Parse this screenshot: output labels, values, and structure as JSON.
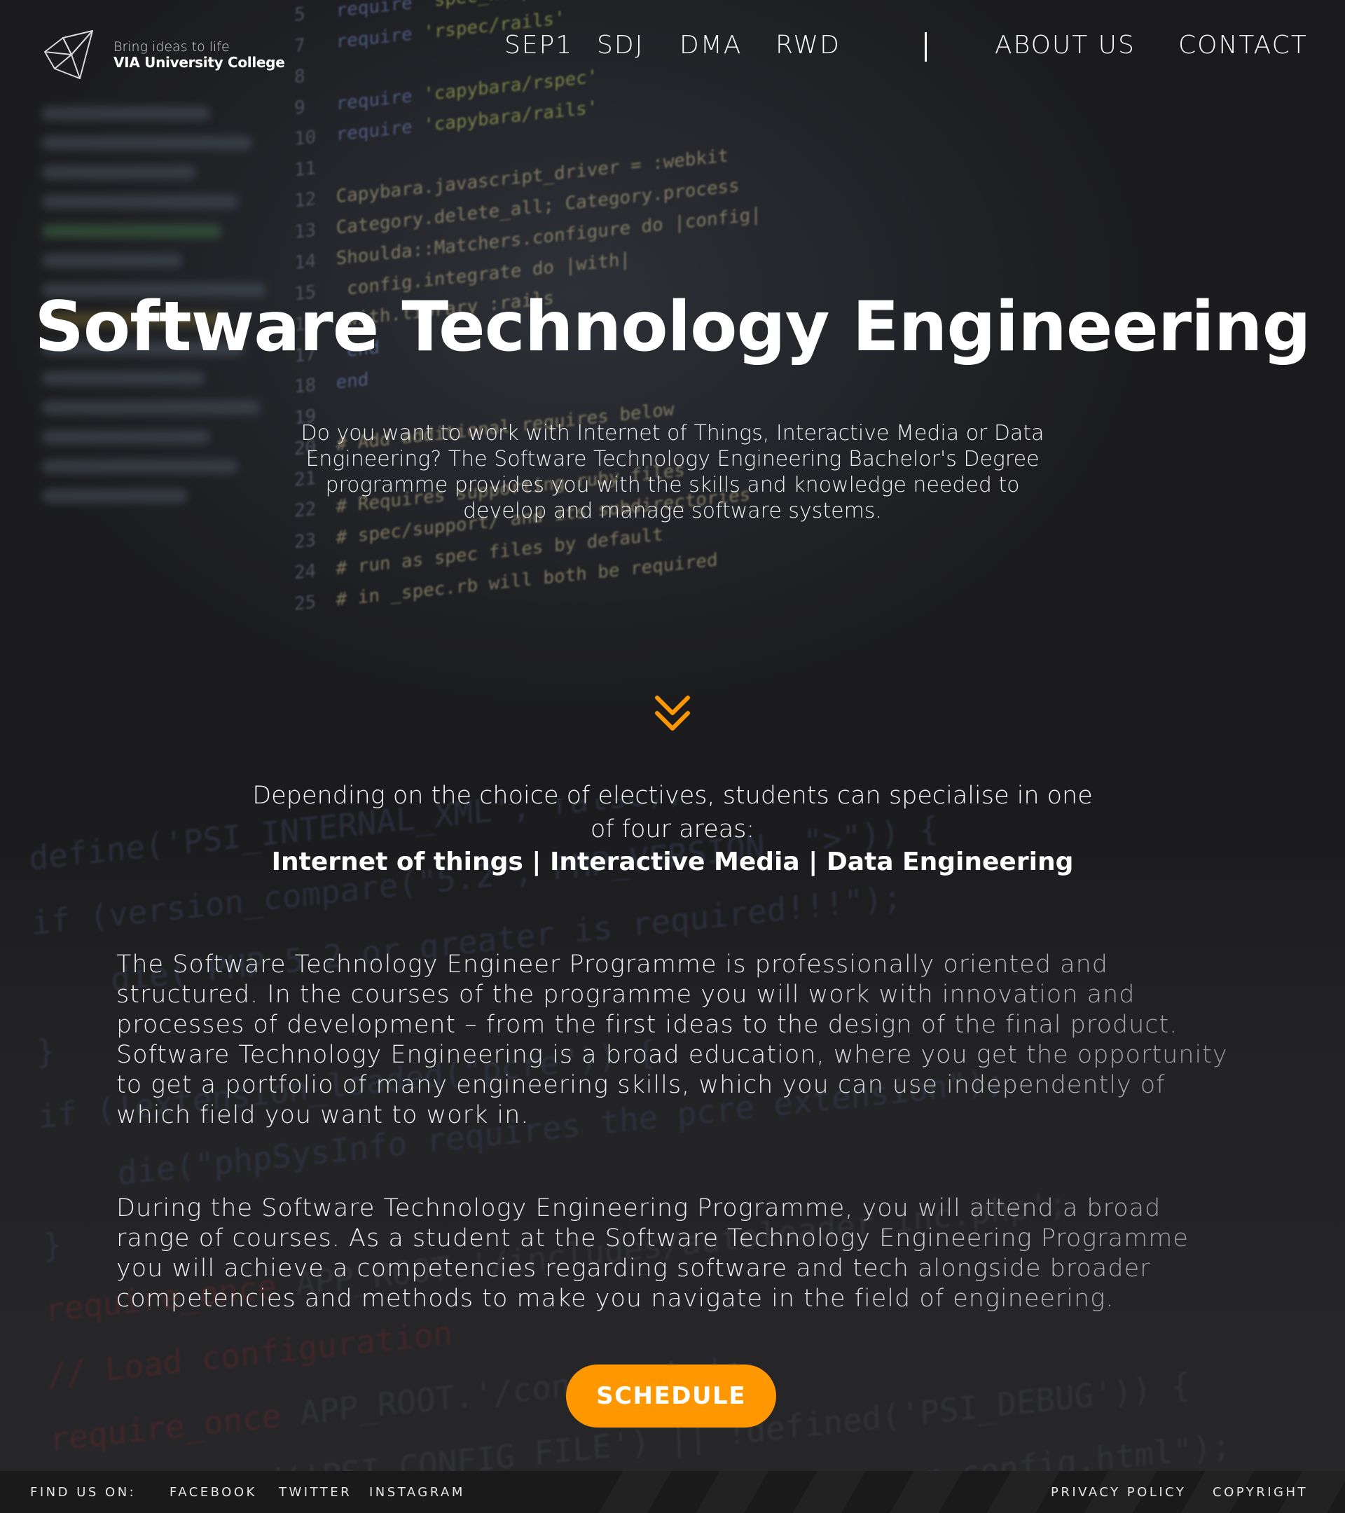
{
  "brand": {
    "tagline": "Bring ideas to life",
    "name": "VIA University College"
  },
  "nav": {
    "links": [
      "SEP1",
      "SDJ",
      "DMA",
      "RWD"
    ],
    "about": "ABOUT US",
    "contact": "CONTACT"
  },
  "hero": {
    "title": "Software Technology Engineering",
    "text": "Do you want to work with Internet of Things, Interactive Media or Data Engineering? The Software Technology Engineering Bachelor's Degree programme provides you with the skills and knowledge needed to develop and manage software systems."
  },
  "specialisation": {
    "intro": "Depending on the choice of electives, students can specialise in one of four areas:",
    "areas": "Internet of things | Interactive Media | Data Engineering"
  },
  "paragraphs": [
    "The Software Technology Engineer Programme is professionally oriented and structured. In the courses of the programme you will work with innovation and processes of development – from the first ideas to the design of the final product. Software Technology Engineering is a broad education, where you get the opportunity to get a portfolio of many engineering skills, which you can use independently of which field you want to work in.",
    "During the Software Technology Engineering Programme, you will attend a broad range of courses. As a student at the Software Technology Engineering Programme you will achieve a competencies regarding software and tech alongside broader competencies and methods to make you navigate in the field of engineering."
  ],
  "cta": {
    "label": "SCHEDULE"
  },
  "footer": {
    "find_us": "FIND US ON:",
    "social": [
      "FACEBOOK",
      "TWITTER",
      "INSTAGRAM"
    ],
    "privacy": "PRIVACY POLICY",
    "copyright": "COPYRIGHT"
  },
  "colors": {
    "accent": "#ff9800",
    "text": "#ffffff",
    "background": "#1e1e20"
  },
  "icons": {
    "logo": "via-logo-icon",
    "scroll": "double-chevron-down-icon"
  }
}
